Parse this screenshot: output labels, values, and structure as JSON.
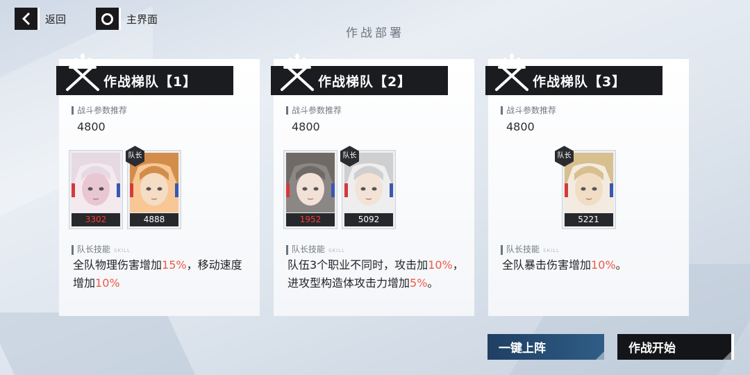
{
  "nav": {
    "back_label": "返回",
    "home_label": "主界面",
    "screen_title": "作战部署"
  },
  "labels": {
    "recommended_power": "战斗参数推荐",
    "leader_skill": "队长技能",
    "leader_skill_en": "SKILL",
    "captain_badge": "队长"
  },
  "teams": [
    {
      "title": "作战梯队【1】",
      "recommended_power": "4800",
      "members": [
        {
          "power": "3302",
          "low": true,
          "captain": false
        },
        {
          "power": "4888",
          "low": false,
          "captain": true
        }
      ],
      "skill": {
        "p1": "全队物理伤害增加",
        "v1": "15%",
        "p2": "，移动速度增加",
        "v2": "10%",
        "p3": ""
      }
    },
    {
      "title": "作战梯队【2】",
      "recommended_power": "4800",
      "members": [
        {
          "power": "1952",
          "low": true,
          "captain": false
        },
        {
          "power": "5092",
          "low": false,
          "captain": true
        }
      ],
      "skill": {
        "p1": "队伍3个职业不同时，攻击加",
        "v1": "10%",
        "p2": "，进攻型构造体攻击力增加",
        "v2": "5%",
        "p3": "。"
      }
    },
    {
      "title": "作战梯队【3】",
      "recommended_power": "4800",
      "members": [
        {
          "power": "5221",
          "low": false,
          "captain": true
        }
      ],
      "skill": {
        "p1": "全队暴击伤害增加",
        "v1": "10%",
        "p2": "。",
        "v2": "",
        "p3": ""
      }
    }
  ],
  "buttons": {
    "auto_deploy": "一键上阵",
    "start_battle": "作战开始"
  },
  "colors": {
    "highlight": "#f0594a",
    "low_power": "#ff3b30",
    "primary_button": "#2f5d86",
    "dark": "#1b1c1f"
  }
}
